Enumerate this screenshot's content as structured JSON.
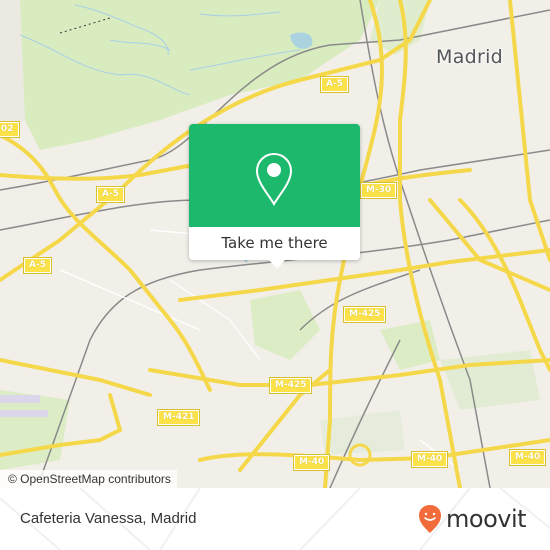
{
  "map": {
    "city_label": "Madrid",
    "road_shields": [
      {
        "label": "A-5",
        "id": "a5-north"
      },
      {
        "label": "A-5",
        "id": "a5-west"
      },
      {
        "label": "A-5",
        "id": "a5-southwest"
      },
      {
        "label": "M-30",
        "id": "m30"
      },
      {
        "label": "M-425",
        "id": "m425-east"
      },
      {
        "label": "M-425",
        "id": "m425-south"
      },
      {
        "label": "M-421",
        "id": "m421"
      },
      {
        "label": "M-40",
        "id": "m40-center"
      },
      {
        "label": "M-40",
        "id": "m40-right"
      },
      {
        "label": "M-40",
        "id": "m40-far-right"
      },
      {
        "label": "02",
        "id": "r02-partial"
      }
    ],
    "attribution": "© OpenStreetMap contributors",
    "colors": {
      "land": "#f2efe9",
      "park": "#d9ecc0",
      "water": "#aad3df",
      "motorway": "#fbe24a",
      "rail": "#8a8a8a"
    }
  },
  "popup": {
    "icon": "map-pin-icon",
    "button_label": "Take me there",
    "color": "#1cb86c"
  },
  "footer": {
    "place_title": "Cafeteria Vanessa, Madrid",
    "brand": "moovit",
    "brand_color": "#f26b3a"
  }
}
